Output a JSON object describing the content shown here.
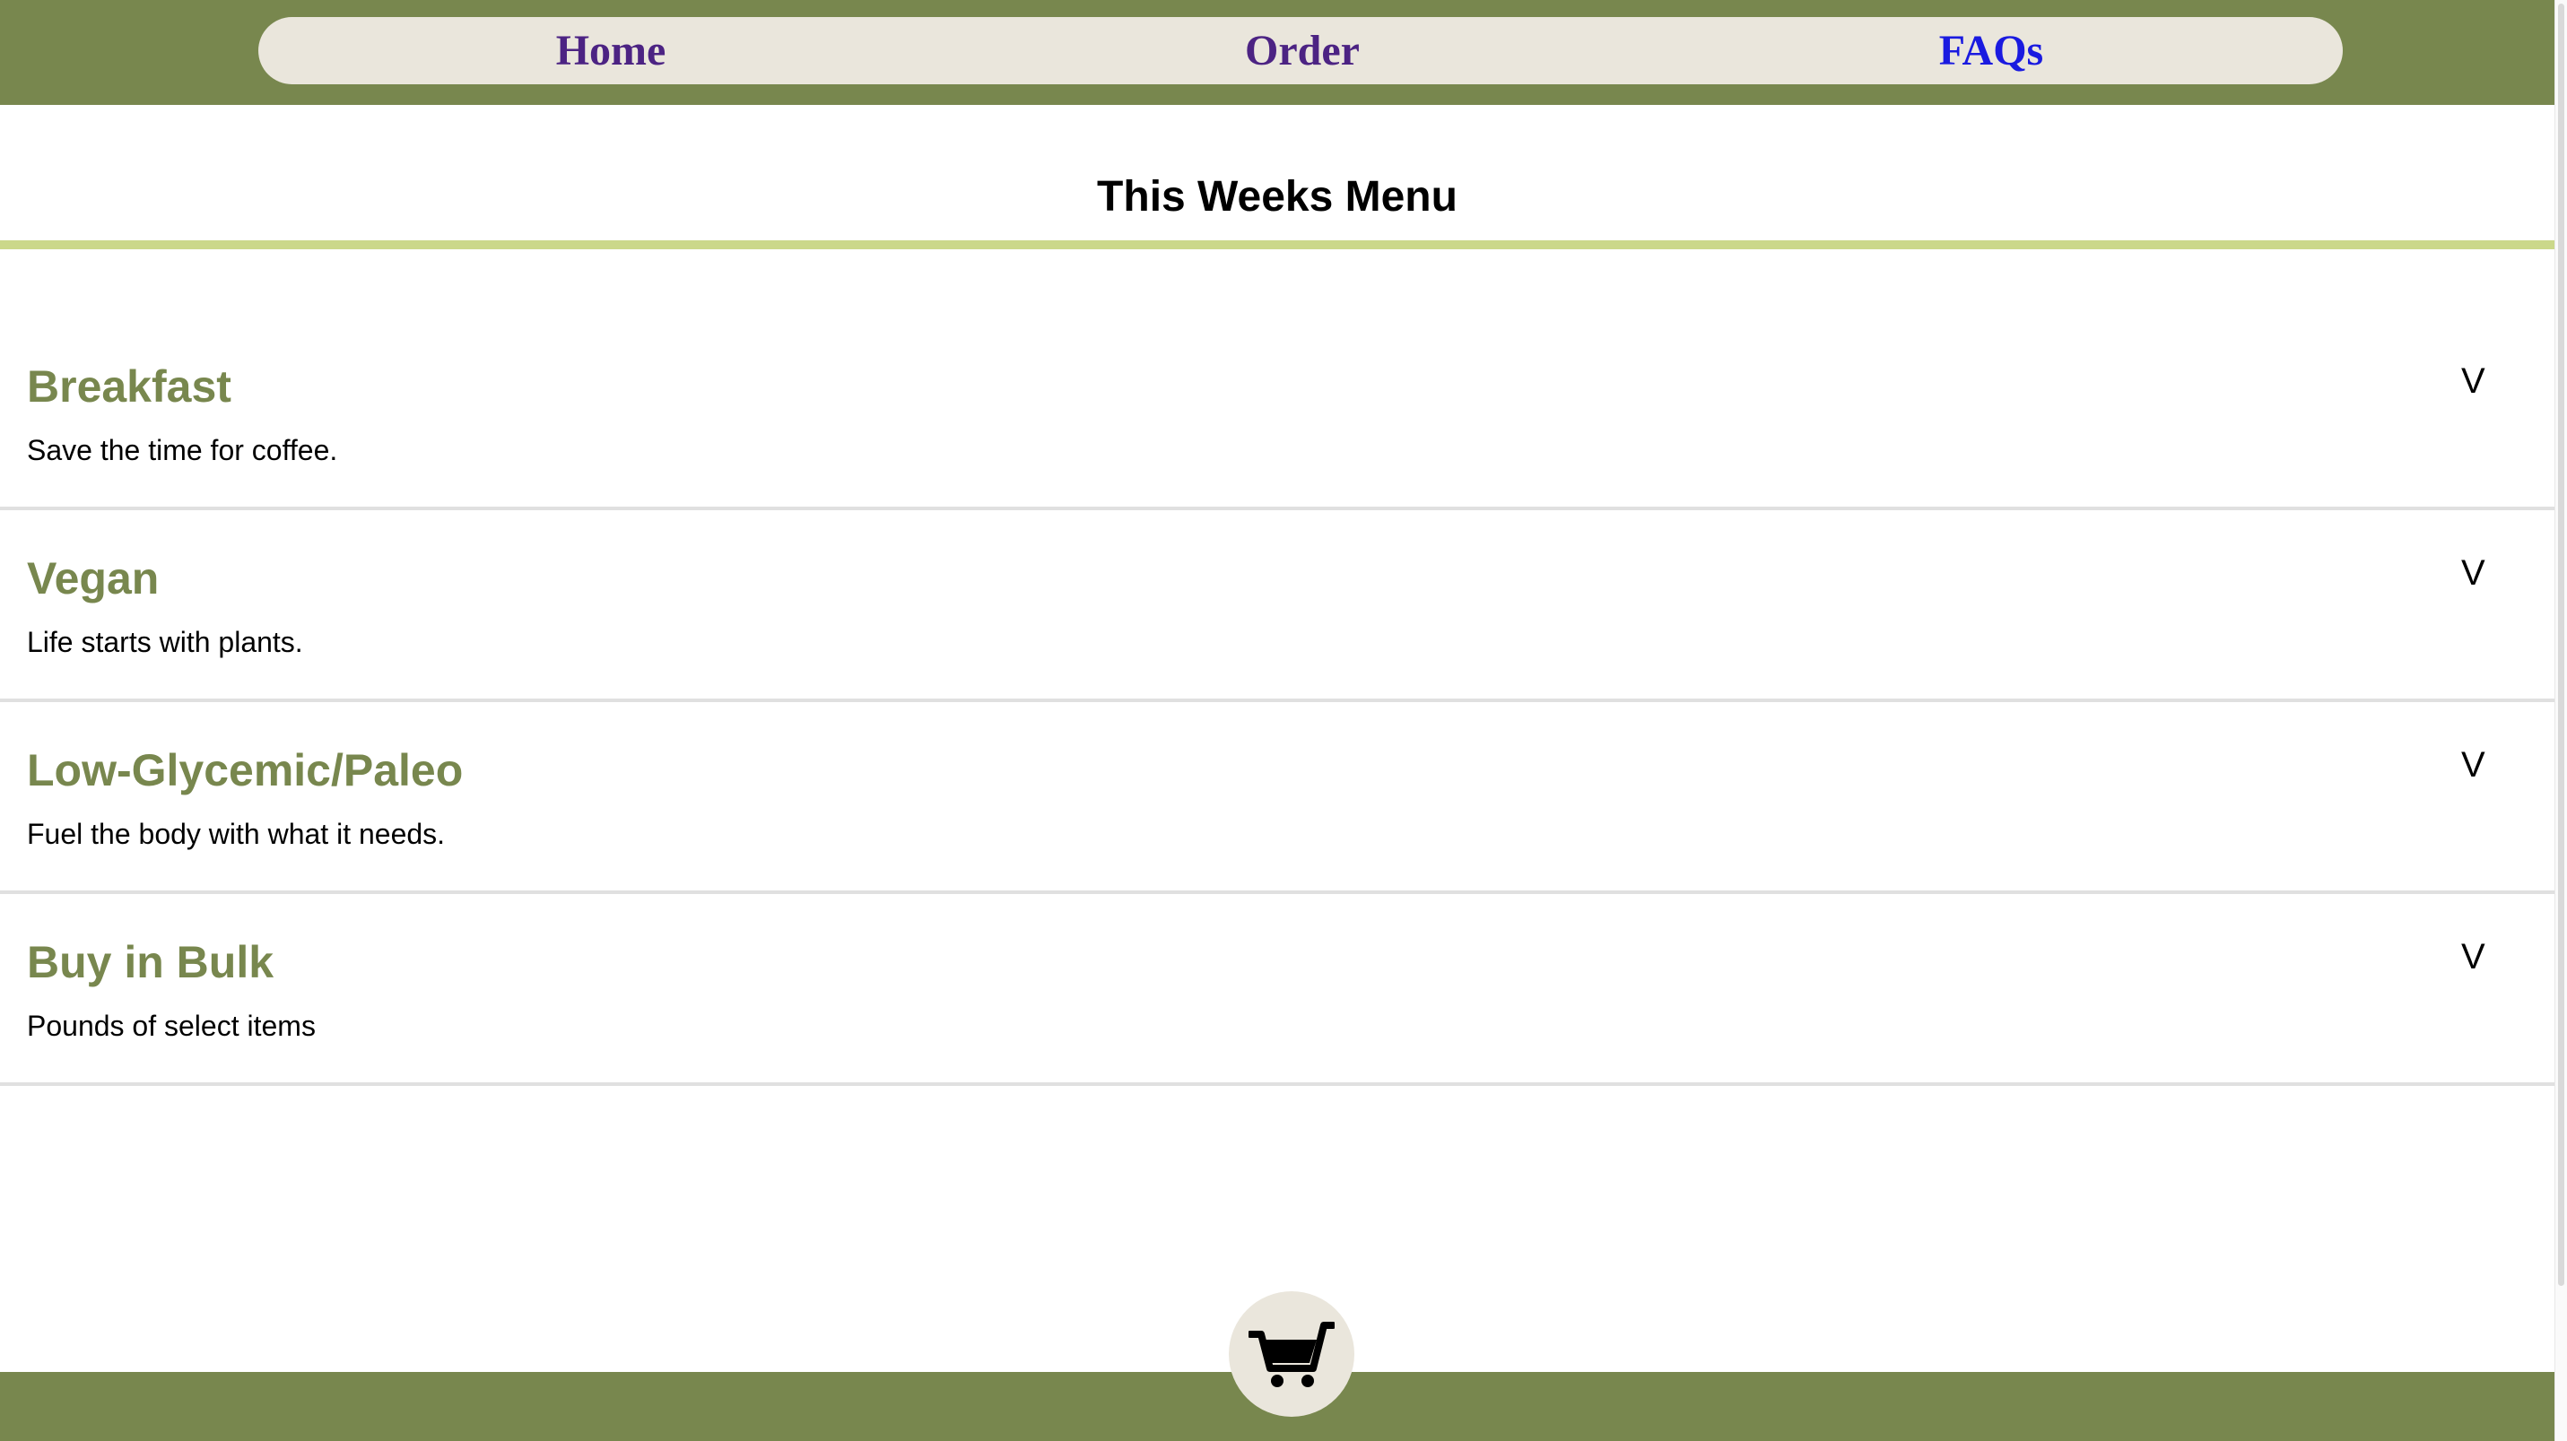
{
  "nav": {
    "home": "Home",
    "order": "Order",
    "faqs": "FAQs"
  },
  "page_title": "This Weeks Menu",
  "menu": [
    {
      "title": "Breakfast",
      "description": "Save the time for coffee.",
      "toggle": "V"
    },
    {
      "title": "Vegan",
      "description": "Life starts with plants.",
      "toggle": "V"
    },
    {
      "title": "Low-Glycemic/Paleo",
      "description": "Fuel the body with what it needs.",
      "toggle": "V"
    },
    {
      "title": "Buy in Bulk",
      "description": "Pounds of select items",
      "toggle": "V"
    }
  ],
  "footer": {
    "cart_icon": "shopping-cart-icon"
  },
  "colors": {
    "header_green": "#78874e",
    "nav_pill": "#eae6dc",
    "nav_link": "#4c2383",
    "nav_link_active": "#1a1ae0",
    "accent_rule": "#cbd88a",
    "category_title": "#78874e",
    "divider": "#e0e0e0"
  }
}
